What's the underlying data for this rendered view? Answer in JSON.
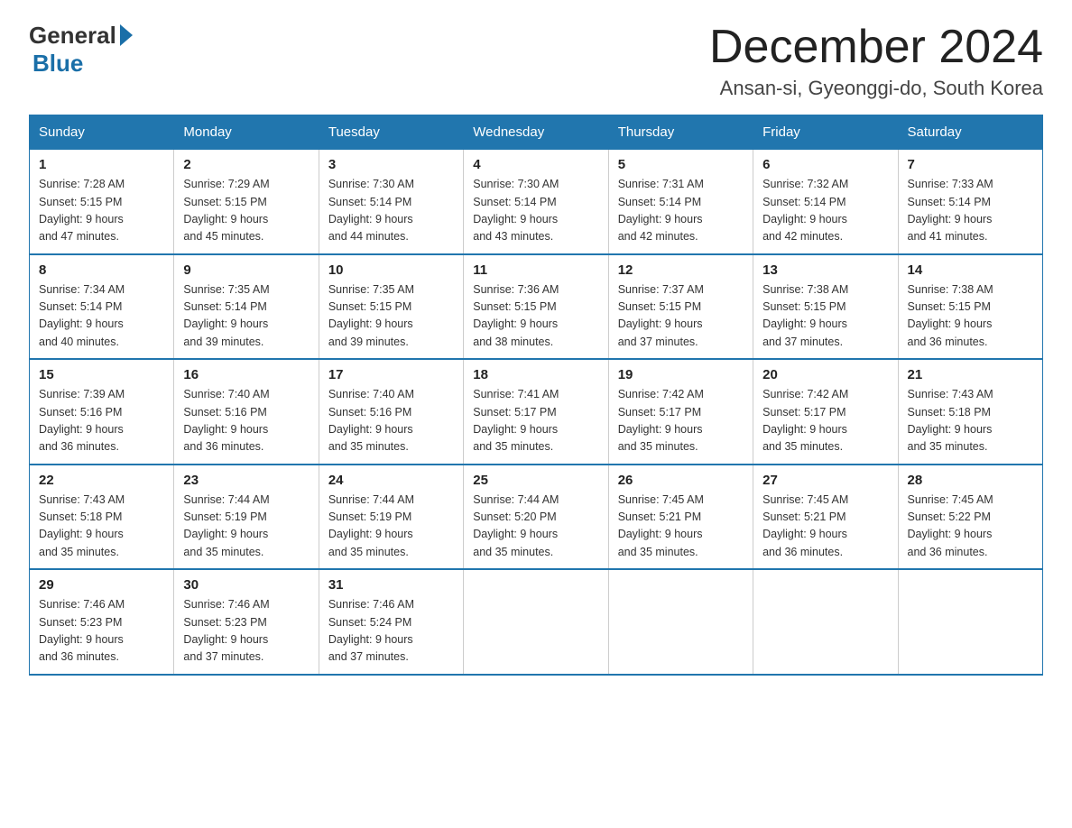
{
  "header": {
    "logo": {
      "general": "General",
      "blue": "Blue",
      "tagline": "Blue"
    },
    "title": "December 2024",
    "location": "Ansan-si, Gyeonggi-do, South Korea"
  },
  "weekdays": [
    "Sunday",
    "Monday",
    "Tuesday",
    "Wednesday",
    "Thursday",
    "Friday",
    "Saturday"
  ],
  "weeks": [
    [
      {
        "day": "1",
        "sunrise": "7:28 AM",
        "sunset": "5:15 PM",
        "daylight": "9 hours and 47 minutes."
      },
      {
        "day": "2",
        "sunrise": "7:29 AM",
        "sunset": "5:15 PM",
        "daylight": "9 hours and 45 minutes."
      },
      {
        "day": "3",
        "sunrise": "7:30 AM",
        "sunset": "5:14 PM",
        "daylight": "9 hours and 44 minutes."
      },
      {
        "day": "4",
        "sunrise": "7:30 AM",
        "sunset": "5:14 PM",
        "daylight": "9 hours and 43 minutes."
      },
      {
        "day": "5",
        "sunrise": "7:31 AM",
        "sunset": "5:14 PM",
        "daylight": "9 hours and 42 minutes."
      },
      {
        "day": "6",
        "sunrise": "7:32 AM",
        "sunset": "5:14 PM",
        "daylight": "9 hours and 42 minutes."
      },
      {
        "day": "7",
        "sunrise": "7:33 AM",
        "sunset": "5:14 PM",
        "daylight": "9 hours and 41 minutes."
      }
    ],
    [
      {
        "day": "8",
        "sunrise": "7:34 AM",
        "sunset": "5:14 PM",
        "daylight": "9 hours and 40 minutes."
      },
      {
        "day": "9",
        "sunrise": "7:35 AM",
        "sunset": "5:14 PM",
        "daylight": "9 hours and 39 minutes."
      },
      {
        "day": "10",
        "sunrise": "7:35 AM",
        "sunset": "5:15 PM",
        "daylight": "9 hours and 39 minutes."
      },
      {
        "day": "11",
        "sunrise": "7:36 AM",
        "sunset": "5:15 PM",
        "daylight": "9 hours and 38 minutes."
      },
      {
        "day": "12",
        "sunrise": "7:37 AM",
        "sunset": "5:15 PM",
        "daylight": "9 hours and 37 minutes."
      },
      {
        "day": "13",
        "sunrise": "7:38 AM",
        "sunset": "5:15 PM",
        "daylight": "9 hours and 37 minutes."
      },
      {
        "day": "14",
        "sunrise": "7:38 AM",
        "sunset": "5:15 PM",
        "daylight": "9 hours and 36 minutes."
      }
    ],
    [
      {
        "day": "15",
        "sunrise": "7:39 AM",
        "sunset": "5:16 PM",
        "daylight": "9 hours and 36 minutes."
      },
      {
        "day": "16",
        "sunrise": "7:40 AM",
        "sunset": "5:16 PM",
        "daylight": "9 hours and 36 minutes."
      },
      {
        "day": "17",
        "sunrise": "7:40 AM",
        "sunset": "5:16 PM",
        "daylight": "9 hours and 35 minutes."
      },
      {
        "day": "18",
        "sunrise": "7:41 AM",
        "sunset": "5:17 PM",
        "daylight": "9 hours and 35 minutes."
      },
      {
        "day": "19",
        "sunrise": "7:42 AM",
        "sunset": "5:17 PM",
        "daylight": "9 hours and 35 minutes."
      },
      {
        "day": "20",
        "sunrise": "7:42 AM",
        "sunset": "5:17 PM",
        "daylight": "9 hours and 35 minutes."
      },
      {
        "day": "21",
        "sunrise": "7:43 AM",
        "sunset": "5:18 PM",
        "daylight": "9 hours and 35 minutes."
      }
    ],
    [
      {
        "day": "22",
        "sunrise": "7:43 AM",
        "sunset": "5:18 PM",
        "daylight": "9 hours and 35 minutes."
      },
      {
        "day": "23",
        "sunrise": "7:44 AM",
        "sunset": "5:19 PM",
        "daylight": "9 hours and 35 minutes."
      },
      {
        "day": "24",
        "sunrise": "7:44 AM",
        "sunset": "5:19 PM",
        "daylight": "9 hours and 35 minutes."
      },
      {
        "day": "25",
        "sunrise": "7:44 AM",
        "sunset": "5:20 PM",
        "daylight": "9 hours and 35 minutes."
      },
      {
        "day": "26",
        "sunrise": "7:45 AM",
        "sunset": "5:21 PM",
        "daylight": "9 hours and 35 minutes."
      },
      {
        "day": "27",
        "sunrise": "7:45 AM",
        "sunset": "5:21 PM",
        "daylight": "9 hours and 36 minutes."
      },
      {
        "day": "28",
        "sunrise": "7:45 AM",
        "sunset": "5:22 PM",
        "daylight": "9 hours and 36 minutes."
      }
    ],
    [
      {
        "day": "29",
        "sunrise": "7:46 AM",
        "sunset": "5:23 PM",
        "daylight": "9 hours and 36 minutes."
      },
      {
        "day": "30",
        "sunrise": "7:46 AM",
        "sunset": "5:23 PM",
        "daylight": "9 hours and 37 minutes."
      },
      {
        "day": "31",
        "sunrise": "7:46 AM",
        "sunset": "5:24 PM",
        "daylight": "9 hours and 37 minutes."
      },
      null,
      null,
      null,
      null
    ]
  ]
}
